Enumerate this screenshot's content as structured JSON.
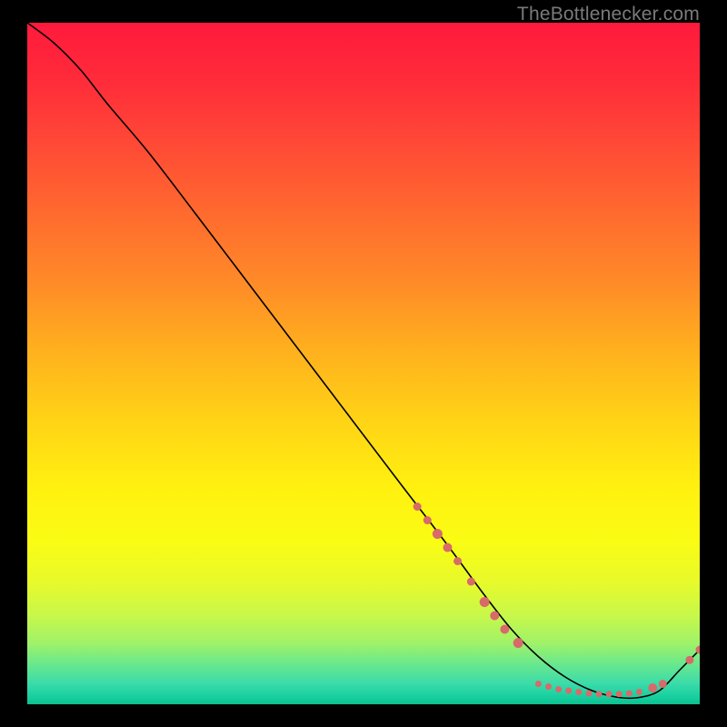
{
  "credit": "TheBottlenecker.com",
  "chart_data": {
    "type": "line",
    "title": "",
    "xlabel": "",
    "ylabel": "",
    "xlim": [
      0,
      100
    ],
    "ylim": [
      0,
      100
    ],
    "curve": {
      "x": [
        0,
        4,
        8,
        12,
        18,
        25,
        35,
        45,
        55,
        62,
        68,
        72,
        76,
        80,
        84,
        88,
        91,
        94,
        97,
        100
      ],
      "y": [
        100,
        97,
        93,
        88,
        81,
        72,
        59,
        46,
        33,
        24,
        16,
        11,
        7,
        4,
        2,
        1,
        1,
        2,
        5,
        8
      ]
    },
    "points": [
      {
        "x": 58,
        "y": 29,
        "r": 4.5
      },
      {
        "x": 59.5,
        "y": 27,
        "r": 4.5
      },
      {
        "x": 61,
        "y": 25,
        "r": 5.5
      },
      {
        "x": 62.5,
        "y": 23,
        "r": 5
      },
      {
        "x": 64,
        "y": 21,
        "r": 4.5
      },
      {
        "x": 66,
        "y": 18,
        "r": 4.5
      },
      {
        "x": 68,
        "y": 15,
        "r": 5.5
      },
      {
        "x": 69.5,
        "y": 13,
        "r": 5
      },
      {
        "x": 71,
        "y": 11,
        "r": 5
      },
      {
        "x": 73,
        "y": 9,
        "r": 5.5
      },
      {
        "x": 76,
        "y": 3.0,
        "r": 3.5
      },
      {
        "x": 77.5,
        "y": 2.6,
        "r": 3.5
      },
      {
        "x": 79,
        "y": 2.2,
        "r": 3.5
      },
      {
        "x": 80.5,
        "y": 2.0,
        "r": 3.5
      },
      {
        "x": 82,
        "y": 1.8,
        "r": 3.5
      },
      {
        "x": 83.5,
        "y": 1.6,
        "r": 3.5
      },
      {
        "x": 85,
        "y": 1.5,
        "r": 3.5
      },
      {
        "x": 86.5,
        "y": 1.5,
        "r": 3.5
      },
      {
        "x": 88,
        "y": 1.5,
        "r": 3.5
      },
      {
        "x": 89.5,
        "y": 1.6,
        "r": 3.5
      },
      {
        "x": 91,
        "y": 1.8,
        "r": 3.5
      },
      {
        "x": 93,
        "y": 2.4,
        "r": 5
      },
      {
        "x": 94.5,
        "y": 3.0,
        "r": 4.5
      },
      {
        "x": 98.5,
        "y": 6.5,
        "r": 4.5
      },
      {
        "x": 100,
        "y": 8.0,
        "r": 4.5
      }
    ],
    "point_color": "#d86a6a"
  }
}
